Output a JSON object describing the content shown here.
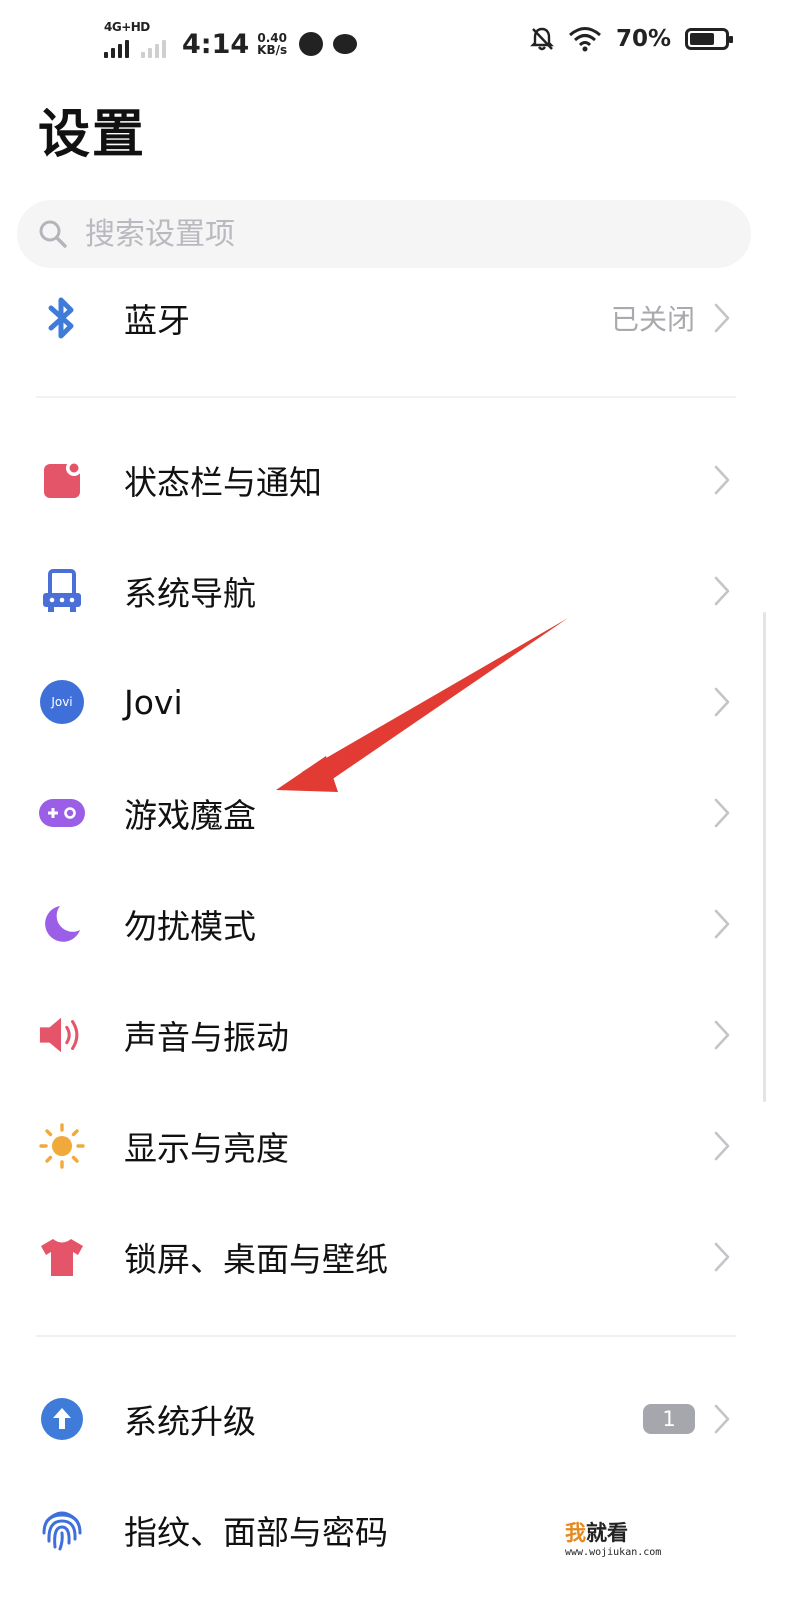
{
  "status_bar": {
    "network_tag": "4G+HD",
    "time": "4:14",
    "speed_value": "0.40",
    "speed_unit": "KB/s",
    "battery_text": "70%",
    "battery_level": 0.7
  },
  "title": "设置",
  "search": {
    "placeholder": "搜索设置项"
  },
  "items": [
    {
      "label": "蓝牙",
      "value": "已关闭",
      "icon": "bluetooth-icon"
    },
    {
      "label": "状态栏与通知",
      "icon": "status-bar-notification-icon"
    },
    {
      "label": "系统导航",
      "icon": "system-navigation-icon"
    },
    {
      "label": "Jovi",
      "icon": "jovi-icon",
      "icon_text": "Jovi"
    },
    {
      "label": "游戏魔盒",
      "icon": "game-box-icon"
    },
    {
      "label": "勿扰模式",
      "icon": "do-not-disturb-moon-icon"
    },
    {
      "label": "声音与振动",
      "icon": "speaker-icon"
    },
    {
      "label": "显示与亮度",
      "icon": "sun-icon"
    },
    {
      "label": "锁屏、桌面与壁纸",
      "icon": "tshirt-icon"
    },
    {
      "label": "系统升级",
      "icon": "upgrade-arrow-icon",
      "badge": "1"
    },
    {
      "label": "指纹、面部与密码",
      "icon": "fingerprint-icon"
    }
  ],
  "watermark": {
    "brand_a": "我",
    "brand_b": "就看",
    "url": "www.wojiukan.com"
  },
  "colors": {
    "bluetooth": "#3f7bd9",
    "status_bar_icon": "#e4556a",
    "navigation_icon": "#4a6fd6",
    "jovi": "#3f6fd8",
    "game_box": "#9a5fe6",
    "moon": "#9a5fe6",
    "speaker": "#e4556a",
    "sun": "#f0a93a",
    "tshirt": "#e4556a",
    "upgrade": "#3f7bd9",
    "fingerprint": "#3f6fd8",
    "annotation_arrow": "#e23b33"
  }
}
